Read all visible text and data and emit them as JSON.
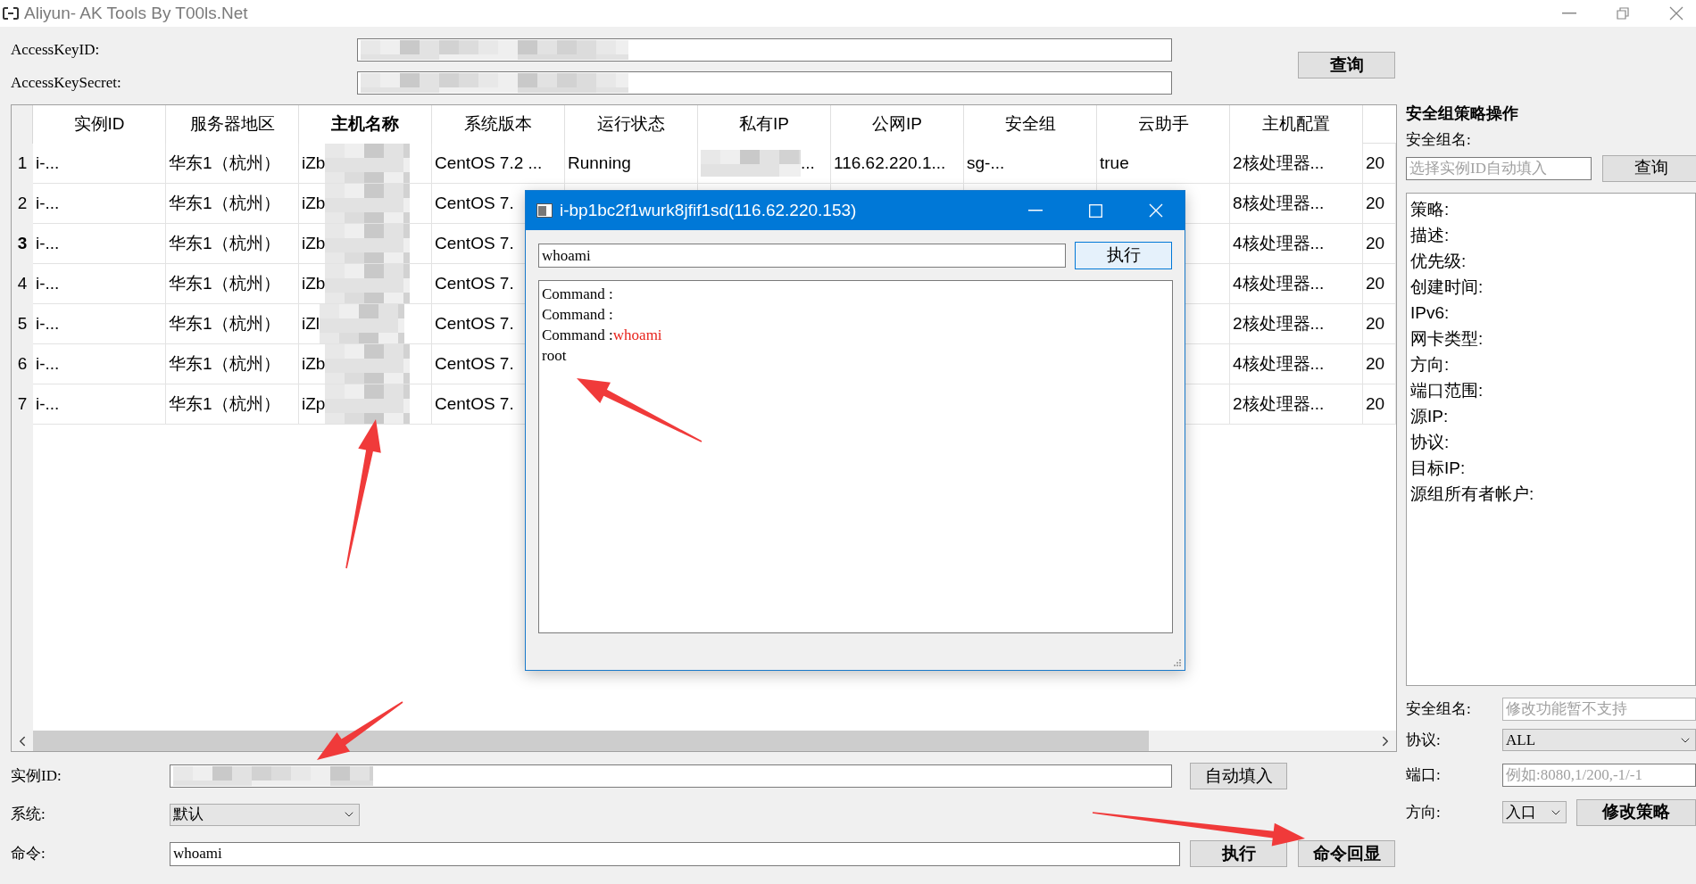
{
  "window": {
    "title": "Aliyun- AK Tools By T00ls.Net"
  },
  "credentials": [
    {
      "label": "AccessKeyID:"
    },
    {
      "label": "AccessKeySecret:"
    }
  ],
  "query_button": "查询",
  "table": {
    "columns": [
      {
        "label": "实例ID",
        "selected": false
      },
      {
        "label": "服务器地区",
        "selected": false
      },
      {
        "label": "主机名称",
        "selected": true
      },
      {
        "label": "系统版本",
        "selected": false
      },
      {
        "label": "运行状态",
        "selected": false
      },
      {
        "label": "私有IP",
        "selected": false
      },
      {
        "label": "公网IP",
        "selected": false
      },
      {
        "label": "安全组",
        "selected": false
      },
      {
        "label": "云助手",
        "selected": false
      },
      {
        "label": "主机配置",
        "selected": false
      }
    ],
    "rows": [
      {
        "number": "1",
        "selected": false,
        "cells": [
          "i-...",
          "华东1（杭州）",
          "iZb",
          "CentOS  7.2 ...",
          "Running",
          "...",
          "116.62.220.1...",
          "sg-...",
          "true",
          "2核处理器...",
          "20"
        ]
      },
      {
        "number": "2",
        "selected": false,
        "cells": [
          "i-...",
          "华东1（杭州）",
          "iZb",
          "CentOS  7.",
          "",
          "",
          "",
          "",
          "",
          "8核处理器...",
          "20"
        ]
      },
      {
        "number": "3",
        "selected": true,
        "cells": [
          "i-...",
          "华东1（杭州）",
          "iZb",
          "CentOS  7.",
          "",
          "",
          "",
          "",
          "",
          "4核处理器...",
          "20"
        ]
      },
      {
        "number": "4",
        "selected": false,
        "cells": [
          "i-...",
          "华东1（杭州）",
          "iZb",
          "CentOS  7.",
          "",
          "",
          "",
          "",
          "",
          "4核处理器...",
          "20"
        ]
      },
      {
        "number": "5",
        "selected": false,
        "cells": [
          "i-...",
          "华东1（杭州）",
          "iZl",
          "CentOS  7.",
          "",
          "",
          "",
          "",
          "",
          "2核处理器...",
          "20"
        ]
      },
      {
        "number": "6",
        "selected": false,
        "cells": [
          "i-...",
          "华东1（杭州）",
          "iZb",
          "CentOS  7.",
          "",
          "",
          "",
          "",
          "",
          "4核处理器...",
          "20"
        ]
      },
      {
        "number": "7",
        "selected": false,
        "cells": [
          "i-...",
          "华东1（杭州）",
          "iZp",
          "CentOS  7.",
          "",
          "",
          "",
          "",
          "",
          "2核处理器...",
          "20"
        ]
      }
    ]
  },
  "command_form": {
    "instance_label": "实例ID:",
    "autofill_button": "自动填入",
    "system_label": "系统:",
    "system_value": "默认",
    "command_label": "命令:",
    "command_value": "whoami",
    "run_button": "执行",
    "echo_button": "命令回显"
  },
  "security_panel": {
    "title": "安全组策略操作",
    "name_label": "安全组名:",
    "name_placeholder": "选择实例ID自动填入",
    "query_button": "查询",
    "info_fields": [
      "策略:",
      "描述:",
      "优先级:",
      "创建时间:",
      "IPv6:",
      "网卡类型:",
      "方向:",
      "端口范围:",
      "源IP:",
      "协议:",
      "目标IP:",
      "源组所有者帐户:"
    ],
    "edit_name_label": "安全组名:",
    "edit_name_placeholder": "修改功能暂不支持",
    "protocol_label": "协议:",
    "protocol_value": "ALL",
    "port_label": "端口:",
    "port_placeholder": "例如:8080,1/200,-1/-1",
    "direction_label": "方向:",
    "direction_value": "入口",
    "modify_button": "修改策略"
  },
  "dialog": {
    "title": "i-bp1bc2f1wurk8jfif1sd(116.62.220.153)",
    "command_value": "whoami",
    "run_button": "执行",
    "output": [
      {
        "text": "Command :"
      },
      {
        "text": "Command :"
      },
      {
        "text": "Command :",
        "highlight": "whoami"
      },
      {
        "text": "root"
      }
    ]
  }
}
